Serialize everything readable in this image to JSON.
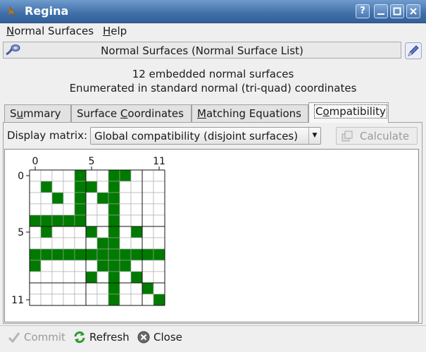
{
  "window": {
    "title": "Regina",
    "buttons": [
      "?",
      "—",
      "□",
      "✕"
    ]
  },
  "menubar": {
    "items": [
      {
        "prefix": "",
        "mnemonic": "N",
        "rest": "ormal Surfaces"
      },
      {
        "prefix": "",
        "mnemonic": "H",
        "rest": "elp"
      }
    ]
  },
  "header": {
    "title": "Normal Surfaces (Normal Surface List)"
  },
  "summary": {
    "line1": "12 embedded normal surfaces",
    "line2": "Enumerated in standard normal (tri-quad) coordinates"
  },
  "tabs": [
    {
      "prefix": "S",
      "mnemonic": "u",
      "rest": "mmary",
      "active": false
    },
    {
      "prefix": "Surface ",
      "mnemonic": "C",
      "rest": "oordinates",
      "active": false
    },
    {
      "prefix": "",
      "mnemonic": "M",
      "rest": "atching Equations",
      "active": false
    },
    {
      "prefix": "C",
      "mnemonic": "o",
      "rest": "mpatibility",
      "active": true
    }
  ],
  "compat": {
    "display_label": "Display matrix:",
    "selected_option": "Global compatibility (disjoint surfaces)",
    "calculate_label": "Calculate"
  },
  "matrix": {
    "size": 12,
    "col_labels": [
      "0",
      "5",
      "11"
    ],
    "row_labels": [
      "0",
      "5",
      "11"
    ],
    "fill_color": "#007a00",
    "cells": [
      [
        0,
        0,
        0,
        0,
        1,
        0,
        0,
        1,
        1,
        0,
        0,
        0
      ],
      [
        0,
        1,
        0,
        0,
        1,
        1,
        0,
        1,
        0,
        0,
        0,
        0
      ],
      [
        0,
        0,
        1,
        0,
        1,
        0,
        1,
        1,
        0,
        0,
        0,
        0
      ],
      [
        0,
        0,
        0,
        0,
        1,
        0,
        0,
        1,
        0,
        0,
        0,
        0
      ],
      [
        1,
        1,
        1,
        1,
        1,
        0,
        0,
        1,
        0,
        0,
        0,
        0
      ],
      [
        0,
        1,
        0,
        0,
        0,
        1,
        0,
        1,
        0,
        1,
        0,
        0
      ],
      [
        0,
        0,
        0,
        0,
        0,
        0,
        1,
        1,
        0,
        0,
        0,
        0
      ],
      [
        1,
        1,
        1,
        1,
        1,
        1,
        1,
        1,
        1,
        1,
        1,
        1
      ],
      [
        1,
        0,
        0,
        0,
        0,
        0,
        1,
        1,
        1,
        0,
        0,
        0
      ],
      [
        0,
        0,
        0,
        0,
        0,
        1,
        0,
        1,
        0,
        1,
        0,
        0
      ],
      [
        0,
        0,
        0,
        0,
        0,
        0,
        0,
        1,
        0,
        0,
        1,
        0
      ],
      [
        0,
        0,
        0,
        0,
        0,
        0,
        0,
        1,
        0,
        0,
        0,
        1
      ]
    ]
  },
  "bottom": {
    "commit_label": "Commit",
    "refresh_label": "Refresh",
    "close_label": "Close"
  }
}
